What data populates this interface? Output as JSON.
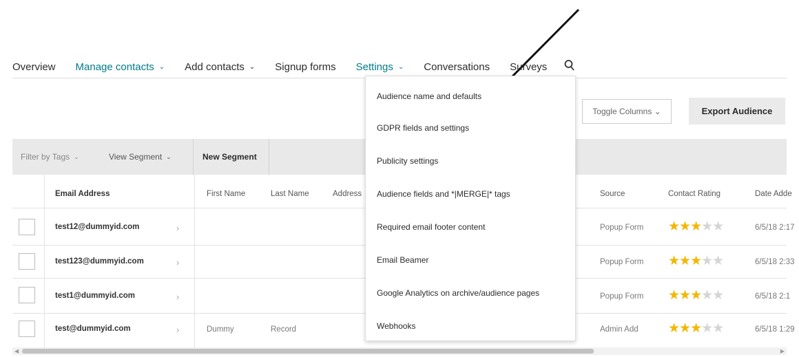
{
  "nav": {
    "items": [
      {
        "label": "Overview"
      },
      {
        "label": "Manage contacts",
        "chevron": "⌄"
      },
      {
        "label": "Add contacts",
        "chevron": "⌄"
      },
      {
        "label": "Signup forms"
      },
      {
        "label": "Settings",
        "chevron": "⌄"
      },
      {
        "label": "Conversations"
      },
      {
        "label": "Surveys"
      }
    ],
    "search_icon": "search-icon"
  },
  "toolbar": {
    "toggle_columns": "Toggle Columns ⌄",
    "export": "Export Audience"
  },
  "filter_bar": {
    "filter_by_tags": "Filter by Tags",
    "view_segment": "View Segment",
    "new_segment": "New Segment",
    "chevron": "⌄"
  },
  "table": {
    "headers": {
      "email": "Email Address",
      "first_name": "First Name",
      "last_name": "Last Name",
      "address": "Address",
      "source": "Source",
      "contact_rating": "Contact Rating",
      "date_added": "Date Adde"
    },
    "rows": [
      {
        "email": "test12@dummyid.com",
        "first": "",
        "last": "",
        "source": "Popup Form",
        "rating": 3,
        "date": "6/5/18 2:17"
      },
      {
        "email": "test123@dummyid.com",
        "first": "",
        "last": "",
        "source": "Popup Form",
        "rating": 3,
        "date": "6/5/18 2:33"
      },
      {
        "email": "test1@dummyid.com",
        "first": "",
        "last": "",
        "source": "Popup Form",
        "rating": 3,
        "date": "6/5/18 2:1"
      },
      {
        "email": "test@dummyid.com",
        "first": "Dummy",
        "last": "Record",
        "source": "Admin Add",
        "rating": 3,
        "date": "6/5/18 1:29"
      }
    ],
    "row_arrow": "›"
  },
  "settings_menu": {
    "items": [
      "Audience name and defaults",
      "GDPR fields and settings",
      "Publicity settings",
      "Audience fields and *|MERGE|* tags",
      "Required email footer content",
      "Email Beamer",
      "Google Analytics on archive/audience pages",
      "Webhooks"
    ]
  },
  "colors": {
    "teal": "#007c89",
    "star": "#f2b705",
    "star_empty": "#d5d5d5",
    "export_bg": "#eaeaea",
    "filter_bg": "#e9e9e9"
  }
}
